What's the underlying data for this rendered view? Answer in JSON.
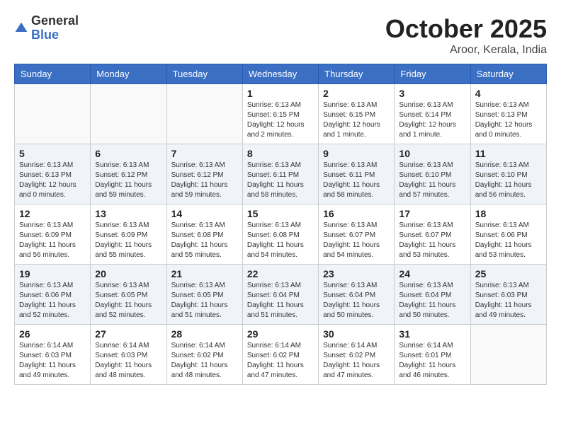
{
  "header": {
    "logo_general": "General",
    "logo_blue": "Blue",
    "month": "October 2025",
    "location": "Aroor, Kerala, India"
  },
  "days_of_week": [
    "Sunday",
    "Monday",
    "Tuesday",
    "Wednesday",
    "Thursday",
    "Friday",
    "Saturday"
  ],
  "weeks": [
    {
      "alt": false,
      "days": [
        {
          "num": "",
          "info": "",
          "empty": true
        },
        {
          "num": "",
          "info": "",
          "empty": true
        },
        {
          "num": "",
          "info": "",
          "empty": true
        },
        {
          "num": "1",
          "info": "Sunrise: 6:13 AM\nSunset: 6:15 PM\nDaylight: 12 hours\nand 2 minutes."
        },
        {
          "num": "2",
          "info": "Sunrise: 6:13 AM\nSunset: 6:15 PM\nDaylight: 12 hours\nand 1 minute."
        },
        {
          "num": "3",
          "info": "Sunrise: 6:13 AM\nSunset: 6:14 PM\nDaylight: 12 hours\nand 1 minute."
        },
        {
          "num": "4",
          "info": "Sunrise: 6:13 AM\nSunset: 6:13 PM\nDaylight: 12 hours\nand 0 minutes."
        }
      ]
    },
    {
      "alt": true,
      "days": [
        {
          "num": "5",
          "info": "Sunrise: 6:13 AM\nSunset: 6:13 PM\nDaylight: 12 hours\nand 0 minutes."
        },
        {
          "num": "6",
          "info": "Sunrise: 6:13 AM\nSunset: 6:12 PM\nDaylight: 11 hours\nand 59 minutes."
        },
        {
          "num": "7",
          "info": "Sunrise: 6:13 AM\nSunset: 6:12 PM\nDaylight: 11 hours\nand 59 minutes."
        },
        {
          "num": "8",
          "info": "Sunrise: 6:13 AM\nSunset: 6:11 PM\nDaylight: 11 hours\nand 58 minutes."
        },
        {
          "num": "9",
          "info": "Sunrise: 6:13 AM\nSunset: 6:11 PM\nDaylight: 11 hours\nand 58 minutes."
        },
        {
          "num": "10",
          "info": "Sunrise: 6:13 AM\nSunset: 6:10 PM\nDaylight: 11 hours\nand 57 minutes."
        },
        {
          "num": "11",
          "info": "Sunrise: 6:13 AM\nSunset: 6:10 PM\nDaylight: 11 hours\nand 56 minutes."
        }
      ]
    },
    {
      "alt": false,
      "days": [
        {
          "num": "12",
          "info": "Sunrise: 6:13 AM\nSunset: 6:09 PM\nDaylight: 11 hours\nand 56 minutes."
        },
        {
          "num": "13",
          "info": "Sunrise: 6:13 AM\nSunset: 6:09 PM\nDaylight: 11 hours\nand 55 minutes."
        },
        {
          "num": "14",
          "info": "Sunrise: 6:13 AM\nSunset: 6:08 PM\nDaylight: 11 hours\nand 55 minutes."
        },
        {
          "num": "15",
          "info": "Sunrise: 6:13 AM\nSunset: 6:08 PM\nDaylight: 11 hours\nand 54 minutes."
        },
        {
          "num": "16",
          "info": "Sunrise: 6:13 AM\nSunset: 6:07 PM\nDaylight: 11 hours\nand 54 minutes."
        },
        {
          "num": "17",
          "info": "Sunrise: 6:13 AM\nSunset: 6:07 PM\nDaylight: 11 hours\nand 53 minutes."
        },
        {
          "num": "18",
          "info": "Sunrise: 6:13 AM\nSunset: 6:06 PM\nDaylight: 11 hours\nand 53 minutes."
        }
      ]
    },
    {
      "alt": true,
      "days": [
        {
          "num": "19",
          "info": "Sunrise: 6:13 AM\nSunset: 6:06 PM\nDaylight: 11 hours\nand 52 minutes."
        },
        {
          "num": "20",
          "info": "Sunrise: 6:13 AM\nSunset: 6:05 PM\nDaylight: 11 hours\nand 52 minutes."
        },
        {
          "num": "21",
          "info": "Sunrise: 6:13 AM\nSunset: 6:05 PM\nDaylight: 11 hours\nand 51 minutes."
        },
        {
          "num": "22",
          "info": "Sunrise: 6:13 AM\nSunset: 6:04 PM\nDaylight: 11 hours\nand 51 minutes."
        },
        {
          "num": "23",
          "info": "Sunrise: 6:13 AM\nSunset: 6:04 PM\nDaylight: 11 hours\nand 50 minutes."
        },
        {
          "num": "24",
          "info": "Sunrise: 6:13 AM\nSunset: 6:04 PM\nDaylight: 11 hours\nand 50 minutes."
        },
        {
          "num": "25",
          "info": "Sunrise: 6:13 AM\nSunset: 6:03 PM\nDaylight: 11 hours\nand 49 minutes."
        }
      ]
    },
    {
      "alt": false,
      "days": [
        {
          "num": "26",
          "info": "Sunrise: 6:14 AM\nSunset: 6:03 PM\nDaylight: 11 hours\nand 49 minutes."
        },
        {
          "num": "27",
          "info": "Sunrise: 6:14 AM\nSunset: 6:03 PM\nDaylight: 11 hours\nand 48 minutes."
        },
        {
          "num": "28",
          "info": "Sunrise: 6:14 AM\nSunset: 6:02 PM\nDaylight: 11 hours\nand 48 minutes."
        },
        {
          "num": "29",
          "info": "Sunrise: 6:14 AM\nSunset: 6:02 PM\nDaylight: 11 hours\nand 47 minutes."
        },
        {
          "num": "30",
          "info": "Sunrise: 6:14 AM\nSunset: 6:02 PM\nDaylight: 11 hours\nand 47 minutes."
        },
        {
          "num": "31",
          "info": "Sunrise: 6:14 AM\nSunset: 6:01 PM\nDaylight: 11 hours\nand 46 minutes."
        },
        {
          "num": "",
          "info": "",
          "empty": true
        }
      ]
    }
  ]
}
